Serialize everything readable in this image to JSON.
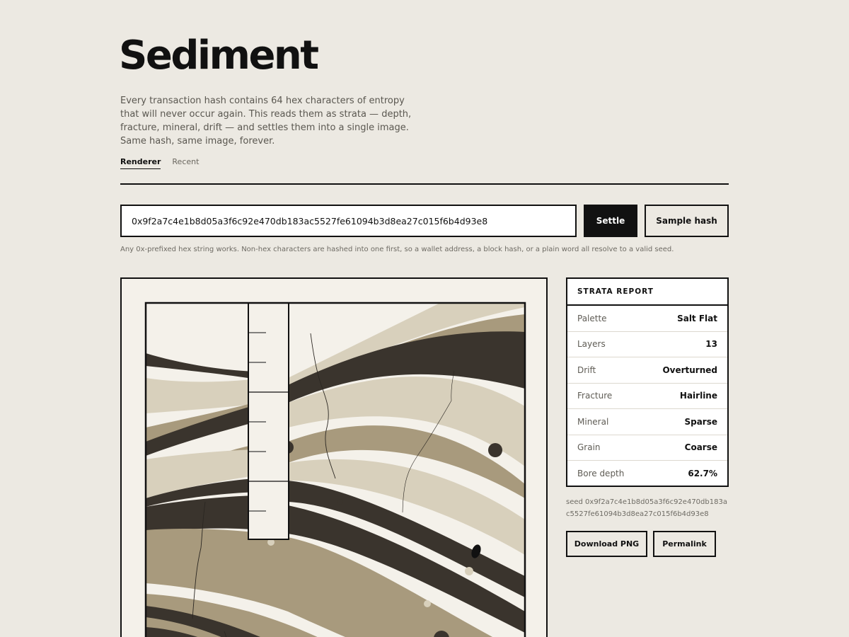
{
  "app": {
    "title": "Sediment",
    "description": "Every transaction hash contains 64 hex characters of entropy that will never occur again. This reads them as strata — depth, fracture, mineral, drift — and settles them into a single image. Same hash, same image, forever."
  },
  "tabs": [
    {
      "label": "Renderer",
      "active": true
    },
    {
      "label": "Recent",
      "active": false
    }
  ],
  "hash_input": {
    "value": "0x9f2a7c4e1b8d05a3f6c92e470db183ac5527fe61094b3d8ea27c015f6b4d93e8"
  },
  "buttons": {
    "settle": "Settle",
    "sample": "Sample hash",
    "download": "Download PNG",
    "permalink": "Permalink"
  },
  "helper_text": "Any 0x-prefixed hex string works. Non-hex characters are hashed into one first, so a wallet address, a block hash, or a plain word all resolve to a valid seed.",
  "report": {
    "heading": "STRATA REPORT",
    "rows": [
      {
        "key": "Palette",
        "value": "Salt Flat"
      },
      {
        "key": "Layers",
        "value": "13"
      },
      {
        "key": "Drift",
        "value": "Overturned"
      },
      {
        "key": "Fracture",
        "value": "Hairline"
      },
      {
        "key": "Mineral",
        "value": "Sparse"
      },
      {
        "key": "Grain",
        "value": "Coarse"
      },
      {
        "key": "Bore depth",
        "value": "62.7%"
      }
    ]
  },
  "seed_text": "seed 0x9f2a7c4e1b8d05a3f6c92e470db183ac5527fe61094b3d8ea27c015f6b4d93e8",
  "colors": {
    "background": "#ece9e2",
    "ink": "#111111",
    "palette_dark": "#3a342d",
    "palette_mid": "#a89a7d",
    "palette_light": "#d8d0bc",
    "palette_paper": "#f4f1ea"
  }
}
